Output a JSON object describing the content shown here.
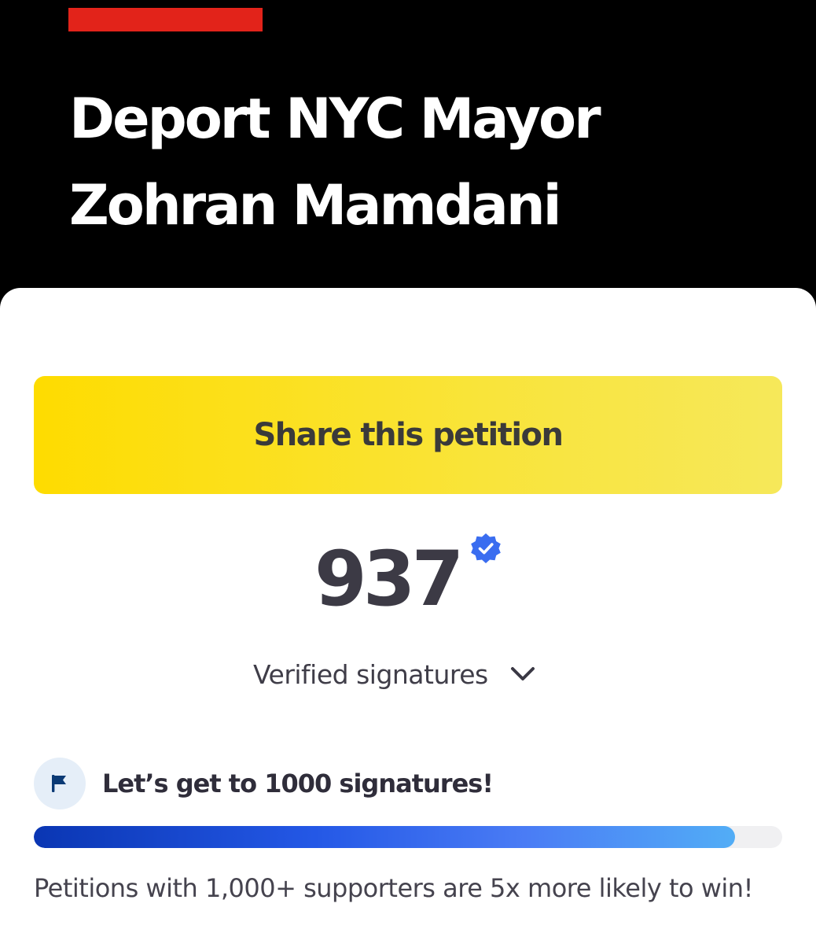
{
  "petition": {
    "title": "Deport NYC Mayor Zohran Mamdani",
    "share_label": "Share this petition",
    "signature_count": "937",
    "signature_label": "Verified signatures",
    "goal_text": "Let’s get to 1000 signatures!",
    "goal_note": "Petitions with 1,000+ supporters are 5x more likely to win!",
    "progress_fraction": 0.937
  },
  "icons": {
    "verified": "verified-check-badge-icon",
    "expand": "chevron-down-icon",
    "goal": "flag-icon"
  },
  "colors": {
    "header_background": "#000000",
    "accent_red": "#e2231a",
    "share_button_yellow": "#fedc00",
    "verified_blue": "#3a6df0",
    "progress_start": "#0a36b3",
    "progress_end": "#52adf6",
    "flag_navy": "#0b3a75"
  }
}
